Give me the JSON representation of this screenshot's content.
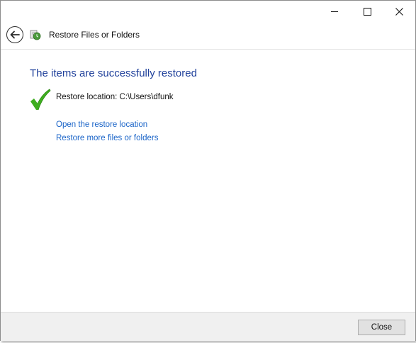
{
  "header": {
    "title": "Restore Files or Folders",
    "back_icon": "back-arrow-icon",
    "app_icon": "file-history-icon"
  },
  "main": {
    "heading": "The items are successfully restored",
    "status_icon": "checkmark-icon",
    "restore_location": "Restore location: C:\\Users\\dfunk",
    "links": {
      "open": "Open the restore location",
      "more": "Restore more files or folders"
    }
  },
  "footer": {
    "close_label": "Close"
  },
  "colors": {
    "heading": "#1e3f9a",
    "link": "#1a64c8",
    "check": "#3fae1f"
  }
}
